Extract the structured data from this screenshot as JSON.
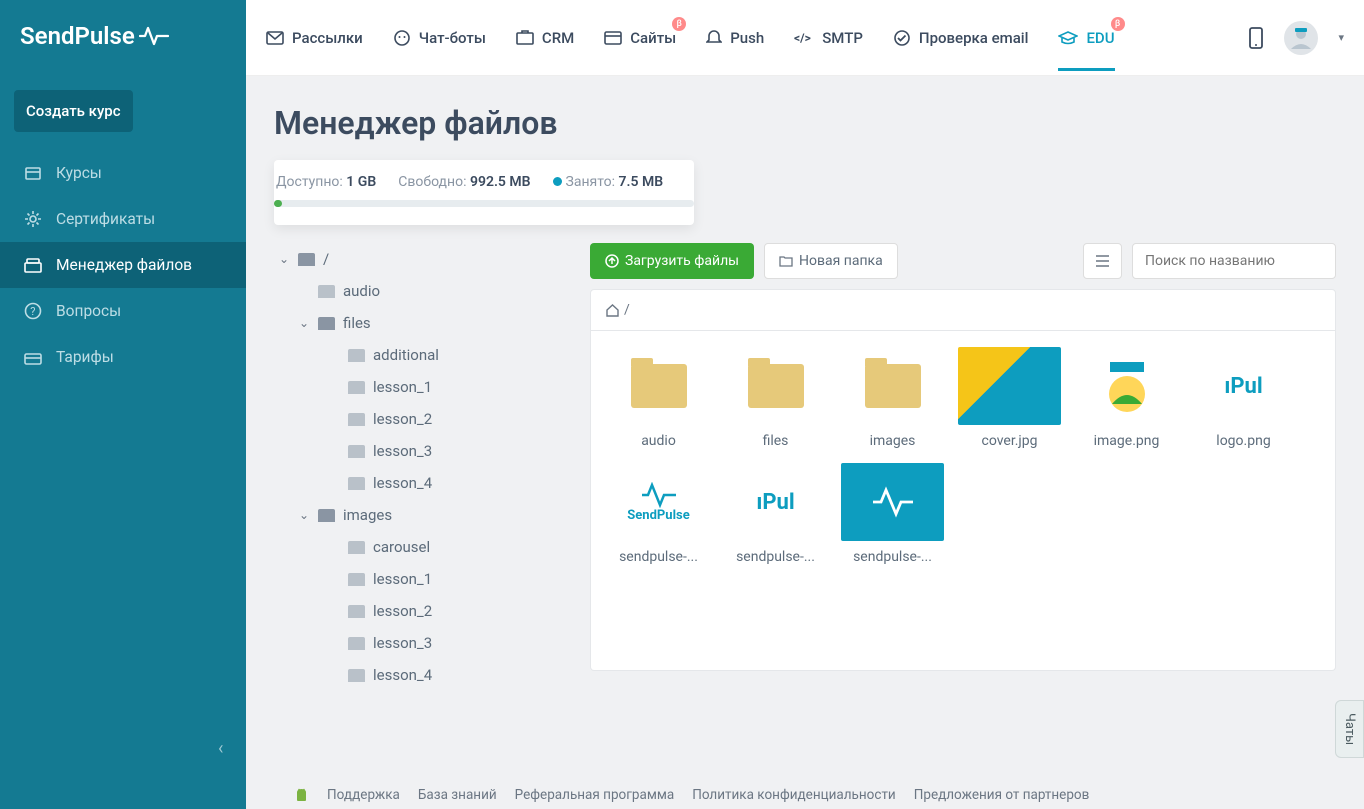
{
  "brand": "SendPulse",
  "nav": {
    "items": [
      {
        "label": "Рассылки"
      },
      {
        "label": "Чат-боты"
      },
      {
        "label": "CRM"
      },
      {
        "label": "Сайты",
        "beta": true
      },
      {
        "label": "Push"
      },
      {
        "label": "SMTP"
      },
      {
        "label": "Проверка email"
      },
      {
        "label": "EDU",
        "beta": true,
        "active": true
      }
    ]
  },
  "sidebar": {
    "create": "Создать курс",
    "items": [
      {
        "label": "Курсы"
      },
      {
        "label": "Сертификаты"
      },
      {
        "label": "Менеджер файлов",
        "active": true
      },
      {
        "label": "Вопросы"
      },
      {
        "label": "Тарифы"
      }
    ]
  },
  "page": {
    "title": "Менеджер файлов"
  },
  "storage": {
    "available_label": "Доступно:",
    "available": "1 GB",
    "free_label": "Свободно:",
    "free": "992.5 MB",
    "used_label": "Занято:",
    "used": "7.5 MB"
  },
  "tree": [
    {
      "name": "/",
      "open": true,
      "depth": 0
    },
    {
      "name": "audio",
      "depth": 1
    },
    {
      "name": "files",
      "open": true,
      "depth": 1
    },
    {
      "name": "additional",
      "depth": 2
    },
    {
      "name": "lesson_1",
      "depth": 2
    },
    {
      "name": "lesson_2",
      "depth": 2
    },
    {
      "name": "lesson_3",
      "depth": 2
    },
    {
      "name": "lesson_4",
      "depth": 2
    },
    {
      "name": "images",
      "open": true,
      "depth": 1
    },
    {
      "name": "carousel",
      "depth": 2
    },
    {
      "name": "lesson_1",
      "depth": 2
    },
    {
      "name": "lesson_2",
      "depth": 2
    },
    {
      "name": "lesson_3",
      "depth": 2
    },
    {
      "name": "lesson_4",
      "depth": 2
    }
  ],
  "toolbar": {
    "upload": "Загрузить файлы",
    "new_folder": "Новая папка",
    "search_placeholder": "Поиск по названию"
  },
  "breadcrumb": "/",
  "files": [
    {
      "name": "audio",
      "type": "folder"
    },
    {
      "name": "files",
      "type": "folder"
    },
    {
      "name": "images",
      "type": "folder"
    },
    {
      "name": "cover.jpg",
      "type": "img",
      "thumb": "cover"
    },
    {
      "name": "image.png",
      "type": "img",
      "thumb": "image"
    },
    {
      "name": "logo.png",
      "type": "img",
      "thumb": "logo"
    },
    {
      "name": "sendpulse-...",
      "type": "img",
      "thumb": "sp1"
    },
    {
      "name": "sendpulse-...",
      "type": "img",
      "thumb": "sp2"
    },
    {
      "name": "sendpulse-...",
      "type": "img",
      "thumb": "sp3"
    }
  ],
  "footer": {
    "links": [
      "Поддержка",
      "База знаний",
      "Реферальная программа",
      "Политика конфиденциальности",
      "Предложения от партнеров"
    ]
  },
  "chat": "Чаты"
}
